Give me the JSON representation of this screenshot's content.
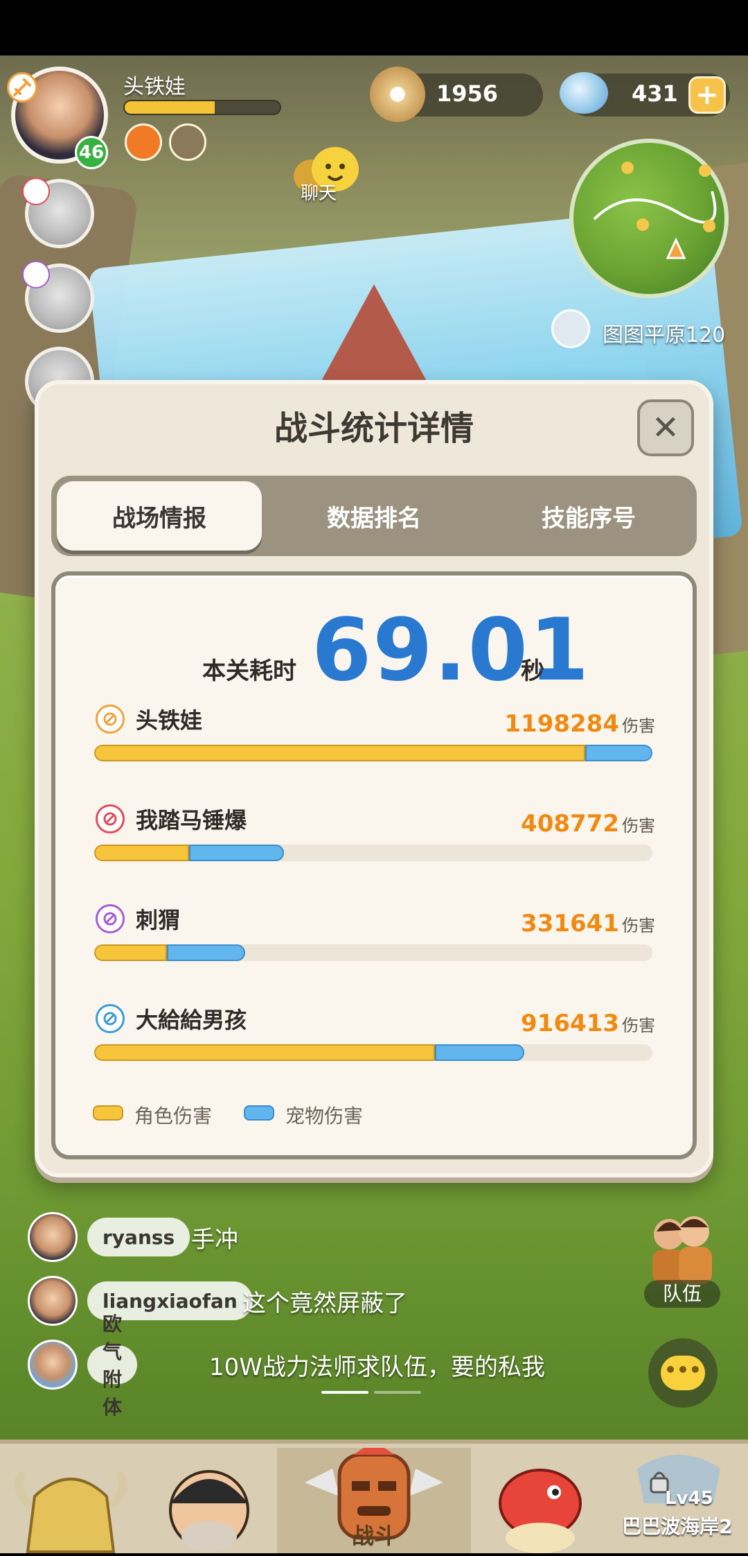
{
  "player": {
    "name": "头铁娃",
    "level": "46",
    "xp_fraction": 0.58
  },
  "currency": {
    "shells": "1956",
    "crystals": "431"
  },
  "chat_button": {
    "label": "聊天"
  },
  "map": {
    "location": "图图平原120"
  },
  "dialog": {
    "title": "战斗统计详情",
    "close_icon": "close-icon",
    "tabs": [
      {
        "label": "战场情报",
        "active": true
      },
      {
        "label": "数据排名",
        "active": false
      },
      {
        "label": "技能序号",
        "active": false
      }
    ],
    "time_label": "本关耗时",
    "time_value": "69.01",
    "time_unit": "秒",
    "damage_unit": "伤害",
    "players": [
      {
        "name": "头铁娃",
        "damage": "1198284",
        "role_fraction": 0.88,
        "pet_fraction": 0.12,
        "icon": "sword-class-icon",
        "color": "#f2a23a"
      },
      {
        "name": "我踏马锤爆",
        "damage": "408772",
        "role_fraction": 0.17,
        "pet_fraction": 0.17,
        "icon": "hammer-class-icon",
        "color": "#e44a5a"
      },
      {
        "name": "刺猬",
        "damage": "331641",
        "role_fraction": 0.13,
        "pet_fraction": 0.14,
        "icon": "spiral-class-icon",
        "color": "#a65bd6"
      },
      {
        "name": "大給給男孩",
        "damage": "916413",
        "role_fraction": 0.61,
        "pet_fraction": 0.16,
        "icon": "wand-class-icon",
        "color": "#3b9bd6"
      }
    ],
    "legend": {
      "role": "角色伤害",
      "pet": "宠物伤害",
      "role_color": "#f7c53b",
      "pet_color": "#62b6ee"
    }
  },
  "chat": [
    {
      "name": "ryanss",
      "message": "手冲"
    },
    {
      "name": "liangxiaofan",
      "message": "这个竟然屏蔽了"
    },
    {
      "name": "欧气附体",
      "message": "10W战力法师求队伍，要的私我"
    }
  ],
  "team_button": {
    "label": "队伍"
  },
  "bottom_nav": {
    "battle_label": "战斗",
    "locked_level": "Lv45",
    "locked_name": "巴巴波海岸2"
  }
}
